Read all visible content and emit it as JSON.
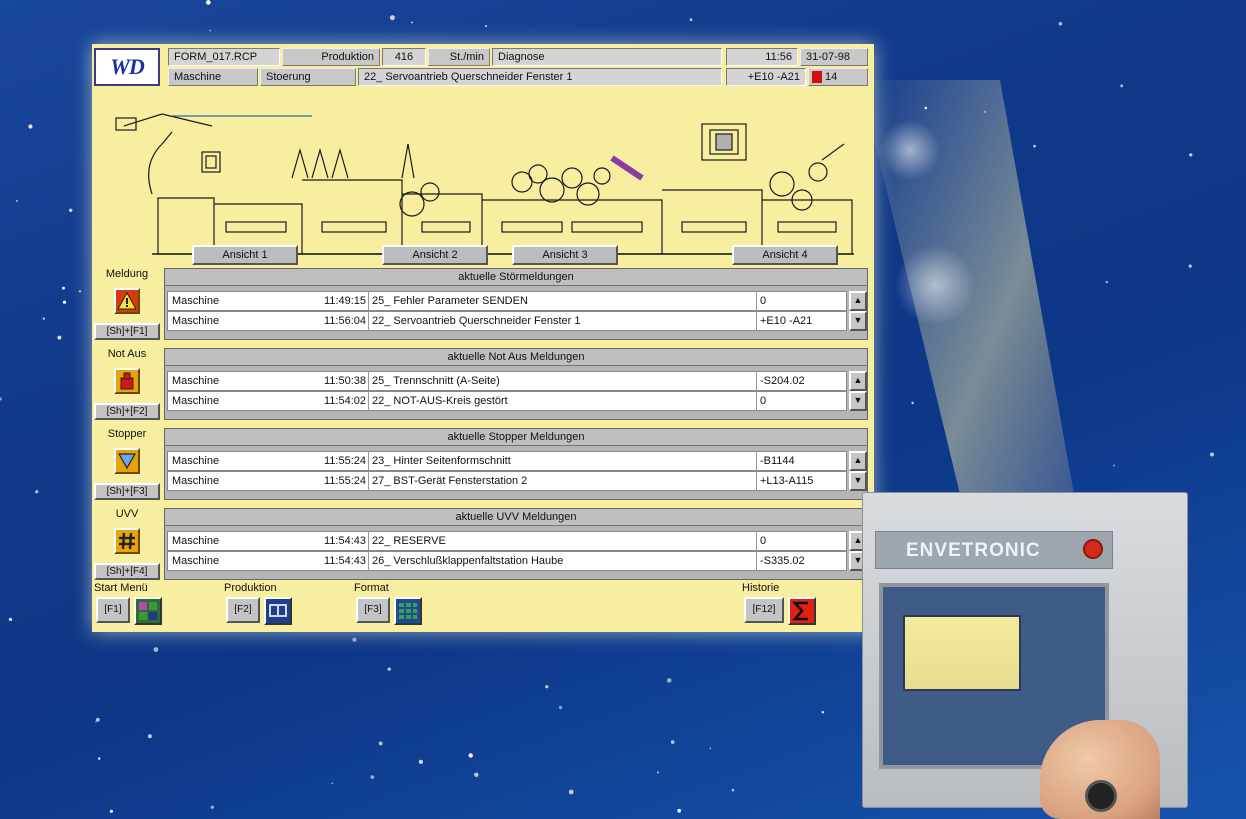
{
  "header": {
    "recipe": "FORM_017.RCP",
    "produktion_label": "Produktion",
    "produktion_value": "416",
    "rate_unit": "St./min",
    "mode": "Diagnose",
    "time": "11:56",
    "date": "31-07-98",
    "maschine_label": "Maschine",
    "stoerung_label": "Stoerung",
    "current_fault": "22_ Servoantrieb Querschneider Fenster 1",
    "fault_code": "+E10 -A21",
    "fault_count": "14"
  },
  "logo_text": "WD",
  "views": [
    "Ansicht 1",
    "Ansicht 2",
    "Ansicht 3",
    "Ansicht 4"
  ],
  "groups": [
    {
      "label": "Meldung",
      "key": "[Sh]+[F1]",
      "icon": "warning-triangle-icon",
      "title": "aktuelle Störmeldungen",
      "rows": [
        {
          "source": "Maschine",
          "time": "11:49:15",
          "text": "25_ Fehler Parameter SENDEN",
          "code": "0"
        },
        {
          "source": "Maschine",
          "time": "11:56:04",
          "text": "22_ Servoantrieb Querschneider Fenster 1",
          "code": "+E10 -A21"
        }
      ]
    },
    {
      "label": "Not Aus",
      "key": "[Sh]+[F2]",
      "icon": "emergency-stop-icon",
      "title": "aktuelle Not Aus Meldungen",
      "rows": [
        {
          "source": "Maschine",
          "time": "11:50:38",
          "text": "25_ Trennschnitt  (A-Seite)",
          "code": "-S204.02"
        },
        {
          "source": "Maschine",
          "time": "11:54:02",
          "text": "22_ NOT-AUS-Kreis gestört",
          "code": "0"
        }
      ]
    },
    {
      "label": "Stopper",
      "key": "[Sh]+[F3]",
      "icon": "stopper-triangle-icon",
      "title": "aktuelle Stopper Meldungen",
      "rows": [
        {
          "source": "Maschine",
          "time": "11:55:24",
          "text": "23_ Hinter  Seitenformschnitt",
          "code": "-B1144"
        },
        {
          "source": "Maschine",
          "time": "11:55:24",
          "text": "27_ BST-Gerät Fensterstation 2",
          "code": "+L13-A115"
        }
      ]
    },
    {
      "label": "UVV",
      "key": "[Sh]+[F4]",
      "icon": "grid-hash-icon",
      "title": "aktuelle UVV Meldungen",
      "rows": [
        {
          "source": "Maschine",
          "time": "11:54:43",
          "text": "22_ RESERVE",
          "code": "0"
        },
        {
          "source": "Maschine",
          "time": "11:54:43",
          "text": "26_ Verschlußklappenfaltstation  Haube",
          "code": "-S335.02"
        }
      ]
    }
  ],
  "footer": [
    {
      "label": "Start Menü",
      "key": "[F1]",
      "icon": "start-menu-icon"
    },
    {
      "label": "Produktion",
      "key": "[F2]",
      "icon": "production-display-icon"
    },
    {
      "label": "Format",
      "key": "[F3]",
      "icon": "format-grid-icon"
    },
    {
      "label": "Historie",
      "key": "[F12]",
      "icon": "sigma-icon"
    }
  ],
  "device": {
    "brand": "ENVETRONIC"
  },
  "colors": {
    "screen_bg": "#f7eea0",
    "panel_gray": "#c8c8c8",
    "alarm_red": "#d01010",
    "icon_orange": "#e6a40a"
  }
}
